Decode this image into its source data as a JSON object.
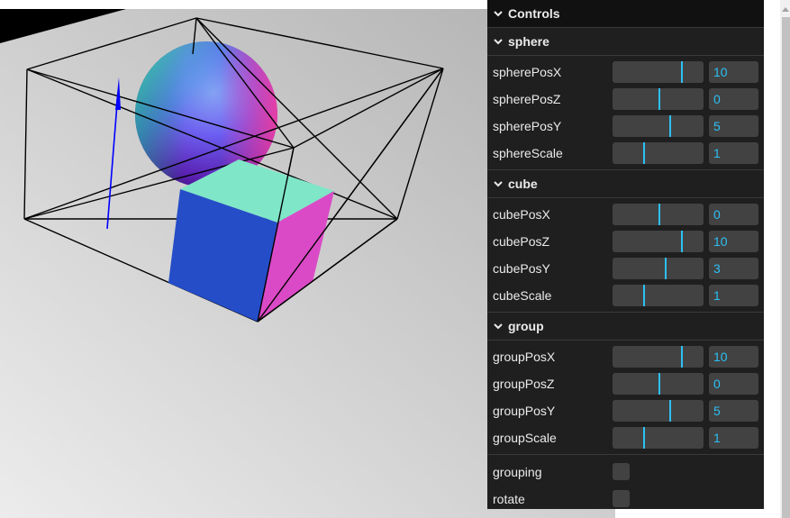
{
  "panel": {
    "title": "Controls",
    "folders": [
      {
        "name": "sphere",
        "controls": [
          {
            "label": "spherePosX",
            "value": "10",
            "fraction": 0.75
          },
          {
            "label": "spherePosZ",
            "value": "0",
            "fraction": 0.5
          },
          {
            "label": "spherePosY",
            "value": "5",
            "fraction": 0.625
          },
          {
            "label": "sphereScale",
            "value": "1",
            "fraction": 0.333
          }
        ]
      },
      {
        "name": "cube",
        "controls": [
          {
            "label": "cubePosX",
            "value": "0",
            "fraction": 0.5
          },
          {
            "label": "cubePosZ",
            "value": "10",
            "fraction": 0.75
          },
          {
            "label": "cubePosY",
            "value": "3",
            "fraction": 0.575
          },
          {
            "label": "cubeScale",
            "value": "1",
            "fraction": 0.333
          }
        ]
      },
      {
        "name": "group",
        "controls": [
          {
            "label": "groupPosX",
            "value": "10",
            "fraction": 0.75
          },
          {
            "label": "groupPosZ",
            "value": "0",
            "fraction": 0.5
          },
          {
            "label": "groupPosY",
            "value": "5",
            "fraction": 0.625
          },
          {
            "label": "groupScale",
            "value": "1",
            "fraction": 0.333
          }
        ]
      }
    ],
    "toggles": [
      {
        "label": "grouping",
        "checked": false
      },
      {
        "label": "rotate",
        "checked": false
      }
    ]
  },
  "colors": {
    "accent": "#2cc0f5",
    "panel_bg": "#1f1f1f",
    "cube_top": "#7fe6c8",
    "cube_front": "#254dc8",
    "cube_side": "#db4ac6",
    "arrow": "#0000ff"
  },
  "scene": {
    "objects": [
      "sphere",
      "cube",
      "wireframe-box",
      "arrow-helper"
    ]
  }
}
